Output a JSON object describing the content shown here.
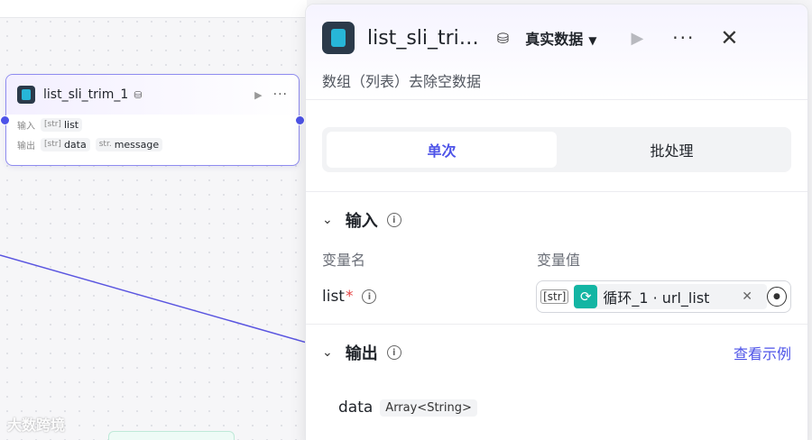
{
  "node": {
    "title": "list_sli_trim_1",
    "input_label": "输入",
    "output_label": "输出",
    "inputs": [
      {
        "type": "[str]",
        "name": "list"
      }
    ],
    "outputs": [
      {
        "type": "[str]",
        "name": "data"
      },
      {
        "type": "str.",
        "name": "message"
      }
    ]
  },
  "watermark": "大数跨境",
  "panel": {
    "title": "list_sli_tri…",
    "data_mode": "真实数据",
    "description": "数组（列表）去除空数据",
    "modes": [
      "单次",
      "批处理"
    ],
    "active_mode": "单次",
    "input_section": {
      "title": "输入",
      "col_name": "变量名",
      "col_value": "变量值",
      "var_name": "list",
      "required_mark": "*",
      "value_type": "[str]",
      "value_ref": "循环_1 · url_list"
    },
    "output_section": {
      "title": "输出",
      "view_example": "查看示例",
      "field_name": "data",
      "field_type": "Array<String>"
    }
  },
  "colors": {
    "accent": "#4d53e8",
    "loop": "#13b5a3",
    "required": "#e54545"
  }
}
